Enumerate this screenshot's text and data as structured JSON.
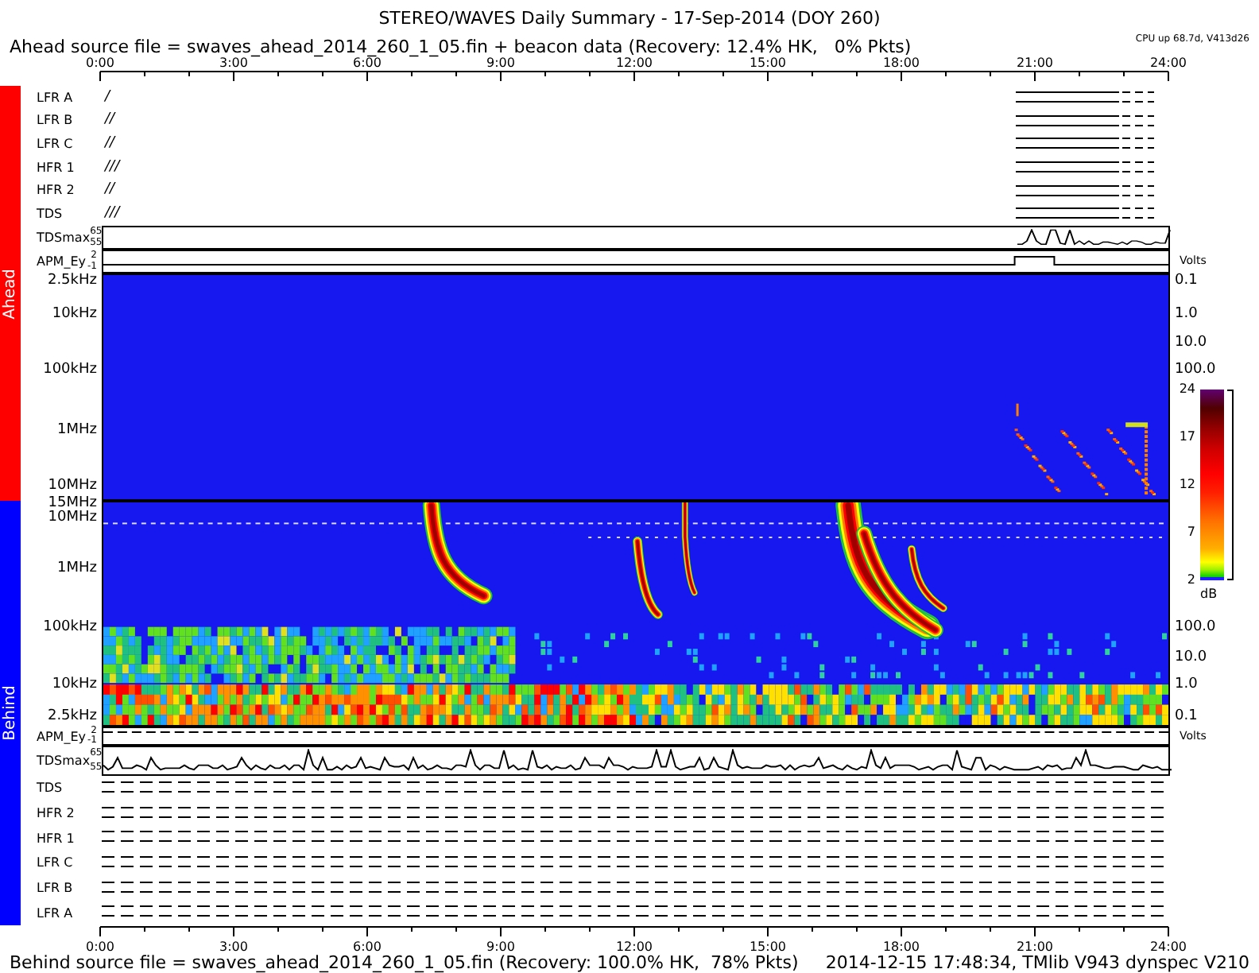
{
  "title": "STEREO/WAVES Daily Summary - 17-Sep-2014 (DOY 260)",
  "header": {
    "source": "Ahead source file = swaves_ahead_2014_260_1_05.fin + beacon data (Recovery: 12.4% HK,   0% Pkts)",
    "status": "CPU up 68.7d, V413d26"
  },
  "time_axis_top": [
    "0:00",
    "3:00",
    "6:00",
    "9:00",
    "12:00",
    "15:00",
    "18:00",
    "21:00",
    "24:00"
  ],
  "ahead": {
    "label": "Ahead",
    "color": "#ff0000",
    "channels": [
      {
        "name": "LFR A",
        "marks": "/"
      },
      {
        "name": "LFR B",
        "marks": "//"
      },
      {
        "name": "LFR C",
        "marks": "//"
      },
      {
        "name": "HFR 1",
        "marks": "///"
      },
      {
        "name": "HFR 2",
        "marks": "//"
      },
      {
        "name": "TDS",
        "marks": "///"
      }
    ],
    "tdsmax": {
      "name": "TDSmax",
      "ticks": [
        "65",
        "55"
      ]
    },
    "apm": {
      "name": "APM_Ey",
      "ticks": [
        "2",
        "-1"
      ],
      "unit": "Volts"
    },
    "freq_ticks": [
      "2.5kHz",
      "10kHz",
      "100kHz",
      "1MHz",
      "10MHz"
    ],
    "right_ticks": [
      "0.1",
      "1.0",
      "10.0",
      "100.0"
    ]
  },
  "colorbar": {
    "ticks": [
      "24",
      "17",
      "12",
      "7",
      "2"
    ],
    "unit": "dB"
  },
  "behind": {
    "label": "Behind",
    "color": "#0000ff",
    "freq_ticks": [
      "15MHz",
      "10MHz",
      "1MHz",
      "100kHz",
      "10kHz",
      "2.5kHz"
    ],
    "right_ticks": [
      "100.0",
      "10.0",
      "1.0",
      "0.1"
    ],
    "apm": {
      "name": "APM_Ey",
      "ticks": [
        "2",
        "-1"
      ],
      "unit": "Volts"
    },
    "tdsmax": {
      "name": "TDSmax",
      "ticks": [
        "65",
        "55"
      ]
    },
    "channels": [
      {
        "name": "TDS"
      },
      {
        "name": "HFR 2"
      },
      {
        "name": "HFR 1"
      },
      {
        "name": "LFR C"
      },
      {
        "name": "LFR B"
      },
      {
        "name": "LFR A"
      }
    ]
  },
  "time_axis_bottom": [
    "0:00",
    "3:00",
    "6:00",
    "9:00",
    "12:00",
    "15:00",
    "18:00",
    "21:00",
    "24:00"
  ],
  "footer": {
    "source": "Behind source file = swaves_ahead_2014_260_1_05.fin (Recovery: 100.0% HK,  78% Pkts)",
    "stamp": "2014-12-15 17:48:34, TMlib V943 dynspec V210"
  }
}
